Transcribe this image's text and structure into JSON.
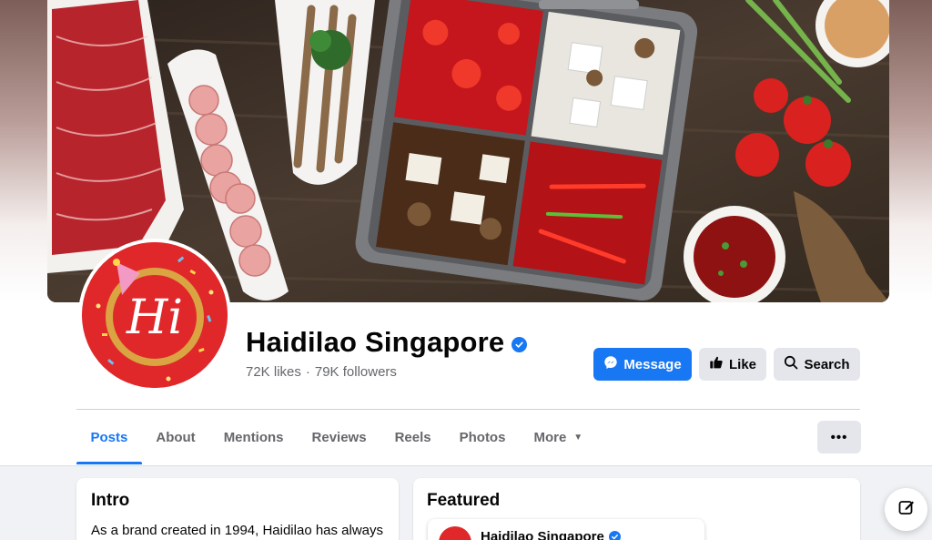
{
  "page": {
    "name": "Haidilao Singapore",
    "likes": "72K likes",
    "separator": "·",
    "followers": "79K followers",
    "logo_text": "Hi"
  },
  "actions": {
    "message_label": "Message",
    "like_label": "Like",
    "search_label": "Search",
    "more_options_label": "•••"
  },
  "tabs": [
    {
      "label": "Posts",
      "active": true
    },
    {
      "label": "About"
    },
    {
      "label": "Mentions"
    },
    {
      "label": "Reviews"
    },
    {
      "label": "Reels"
    },
    {
      "label": "Photos"
    },
    {
      "label": "More"
    }
  ],
  "intro": {
    "title": "Intro",
    "text": "As a brand created in 1994, Haidilao has always"
  },
  "featured": {
    "title": "Featured",
    "item_name": "Haidilao Singapore"
  },
  "icons": {
    "verified": "verified-badge-icon",
    "messenger": "messenger-icon",
    "like": "thumbs-up-icon",
    "search": "search-icon",
    "caret": "caret-down-icon",
    "compose": "compose-icon"
  },
  "colors": {
    "accent": "#1877f2",
    "brand_red": "#e0282b",
    "gold": "#d9a441",
    "secondary_button": "#e4e6eb",
    "muted_text": "#65676b"
  }
}
